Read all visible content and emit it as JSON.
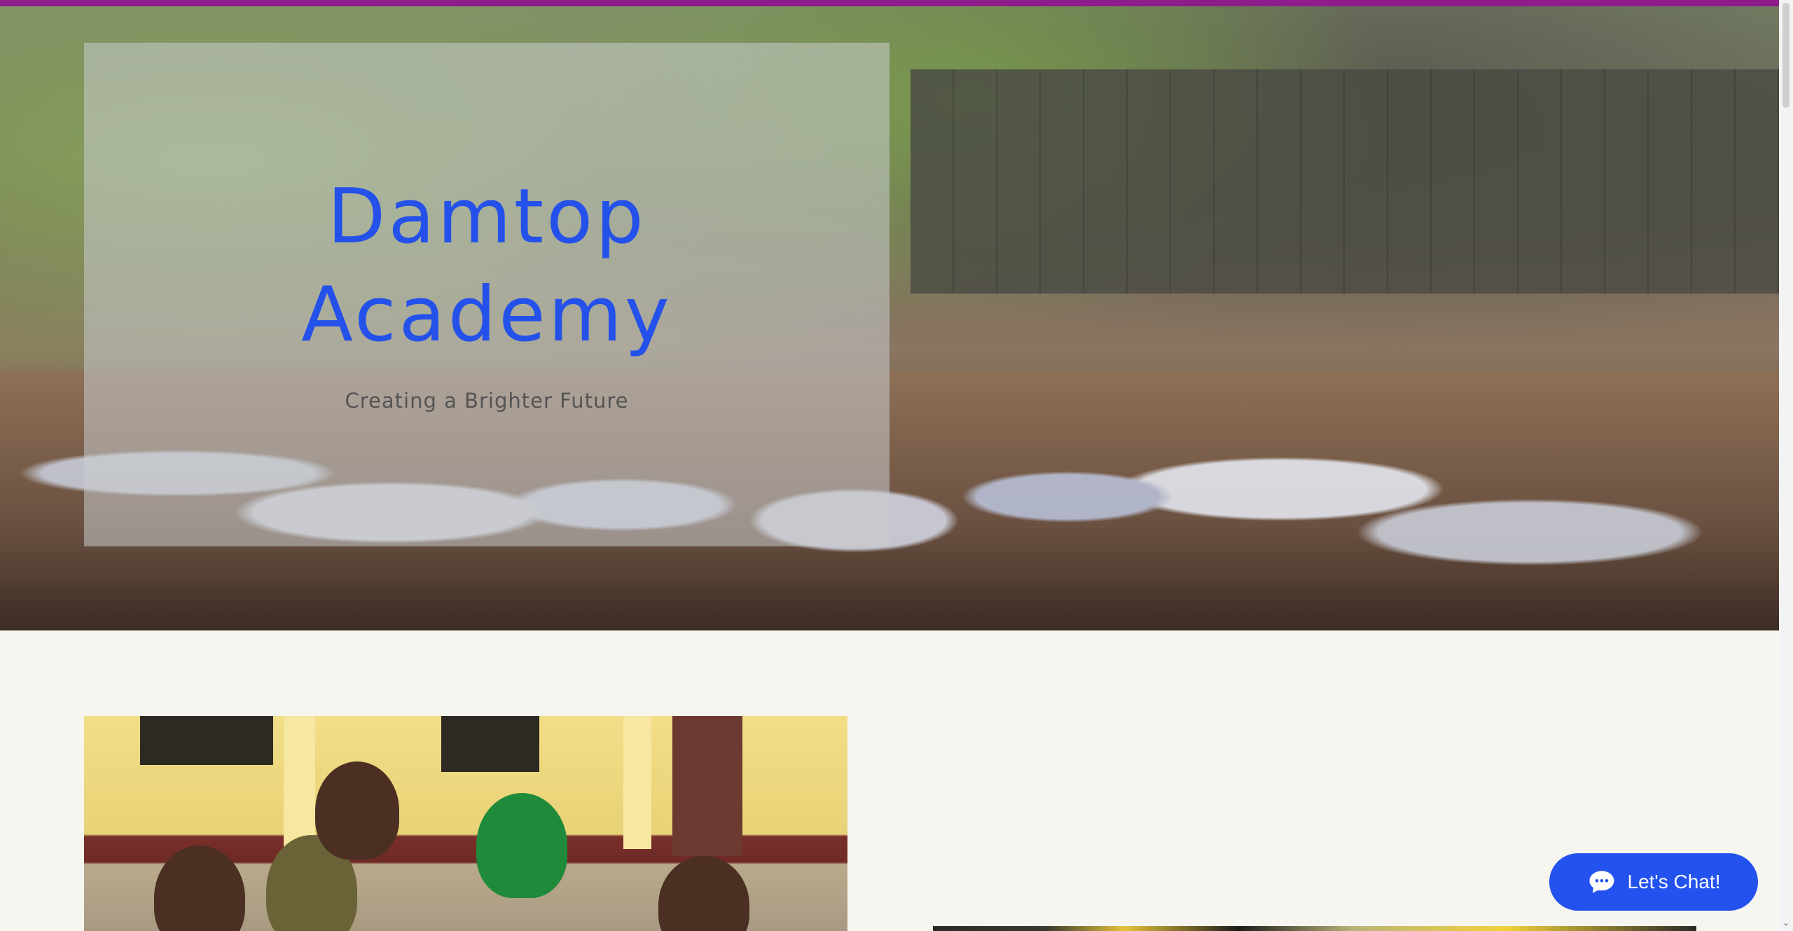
{
  "hero": {
    "title_line1": "Damtop",
    "title_line2": "Academy",
    "subtitle": "Creating a Brighter Future"
  },
  "chat": {
    "label": "Let's Chat!",
    "icon": "chat-bubble-icon",
    "color": "#2352ee"
  },
  "colors": {
    "accent_bar": "#8e1c8b",
    "title": "#2451ea",
    "page_background": "#f6f5ef"
  }
}
